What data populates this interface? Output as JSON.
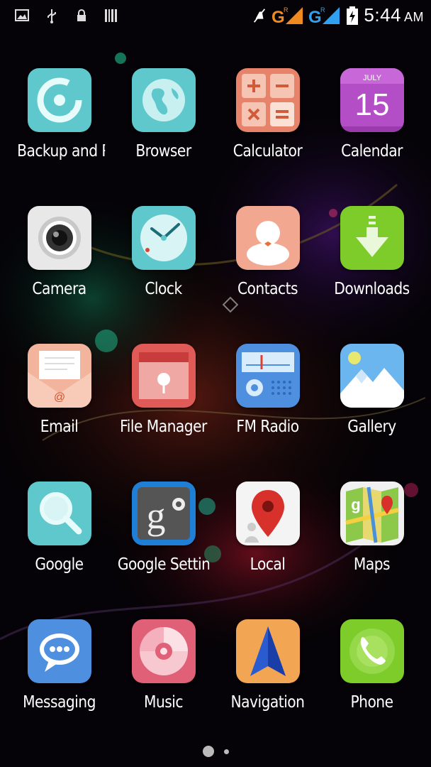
{
  "status_bar": {
    "time": "5:44",
    "ampm": "AM",
    "icons": [
      "image-icon",
      "usb-icon",
      "lock-icon",
      "barcode-icon",
      "mute-icon",
      "signal-g-orange-icon",
      "signal-g-blue-icon",
      "battery-charging-icon"
    ],
    "network_label_1": "G",
    "network_label_2": "G",
    "roaming": "R"
  },
  "apps": [
    {
      "label": "Backup and Re",
      "icon": "backup-icon"
    },
    {
      "label": "Browser",
      "icon": "globe-icon"
    },
    {
      "label": "Calculator",
      "icon": "calculator-icon"
    },
    {
      "label": "Calendar",
      "icon": "calendar-icon",
      "month": "JULY",
      "day": "15"
    },
    {
      "label": "Camera",
      "icon": "camera-icon"
    },
    {
      "label": "Clock",
      "icon": "clock-icon"
    },
    {
      "label": "Contacts",
      "icon": "contacts-icon"
    },
    {
      "label": "Downloads",
      "icon": "download-icon"
    },
    {
      "label": "Email",
      "icon": "envelope-icon"
    },
    {
      "label": "File Manager",
      "icon": "folder-icon"
    },
    {
      "label": "FM Radio",
      "icon": "radio-icon"
    },
    {
      "label": "Gallery",
      "icon": "mountain-icon"
    },
    {
      "label": "Google",
      "icon": "search-icon"
    },
    {
      "label": "Google Setting",
      "icon": "google-settings-icon"
    },
    {
      "label": "Local",
      "icon": "map-pin-icon"
    },
    {
      "label": "Maps",
      "icon": "map-icon"
    },
    {
      "label": "Messaging",
      "icon": "chat-bubble-icon"
    },
    {
      "label": "Music",
      "icon": "disc-icon"
    },
    {
      "label": "Navigation",
      "icon": "navigation-arrow-icon"
    },
    {
      "label": "Phone",
      "icon": "phone-icon"
    }
  ],
  "pager": {
    "pages": 2,
    "current": 1
  },
  "colors": {
    "text": "#ffffff",
    "background": "#050307"
  }
}
